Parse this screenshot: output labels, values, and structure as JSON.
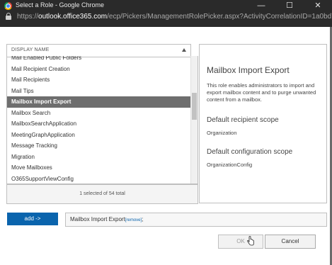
{
  "window": {
    "title": "Select a Role - Google Chrome",
    "controls": {
      "minimize": "—",
      "maximize": "☐",
      "close": "✕"
    }
  },
  "address_bar": {
    "prefix": "https://",
    "host": "outlook.office365.com",
    "path": "/ecp/Pickers/ManagementRolePicker.aspx?ActivityCorrelationID=1a0bd7..."
  },
  "list": {
    "header": "DISPLAY NAME",
    "items": [
      "Mail Enabled Public Folders",
      "Mail Recipient Creation",
      "Mail Recipients",
      "Mail Tips",
      "Mailbox Import Export",
      "Mailbox Search",
      "MailboxSearchApplication",
      "MeetingGraphApplication",
      "Message Tracking",
      "Migration",
      "Move Mailboxes",
      "O365SupportViewConfig"
    ],
    "selected_index": 4,
    "status": "1 selected of 54 total"
  },
  "details": {
    "title": "Mailbox Import Export",
    "description": "This role enables administrators to import and export mailbox content and to purge unwanted content from a mailbox.",
    "recipient_scope_label": "Default recipient scope",
    "recipient_scope_value": "Organization",
    "configuration_scope_label": "Default configuration scope",
    "configuration_scope_value": "OrganizationConfig"
  },
  "add": {
    "button_label": "add ->",
    "selected_value": "Mailbox Import Export",
    "remove_label": "[remove]",
    "suffix": ";"
  },
  "footer": {
    "ok_label": "OK",
    "cancel_label": "Cancel"
  },
  "colors": {
    "titlebar": "#2a2a2a",
    "accent": "#0a64ad",
    "selected_row": "#6e6e6e"
  }
}
